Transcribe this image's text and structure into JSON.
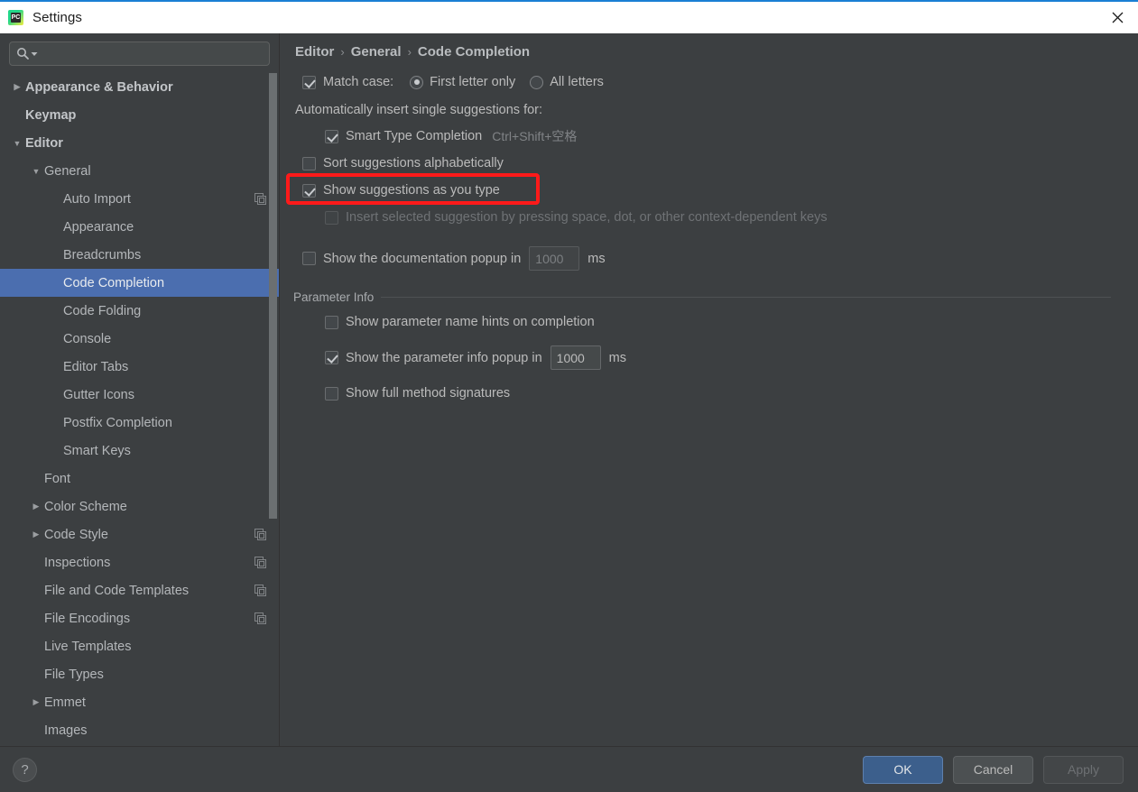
{
  "window": {
    "title": "Settings",
    "app_icon": "pycharm-icon",
    "icon_text": "PC",
    "close_icon": "close-icon",
    "accent_color": "#1a7fd4"
  },
  "sidebar": {
    "search": {
      "placeholder": "",
      "value": "",
      "icon": "search-icon",
      "dropdown_icon": "chevron-down-icon"
    },
    "items": [
      {
        "label": "Appearance & Behavior",
        "indent": 0,
        "arrow": "collapsed",
        "bold": true,
        "selected": false,
        "copy": false
      },
      {
        "label": "Keymap",
        "indent": 0,
        "arrow": "none",
        "bold": true,
        "selected": false,
        "copy": false
      },
      {
        "label": "Editor",
        "indent": 0,
        "arrow": "expanded",
        "bold": true,
        "selected": false,
        "copy": false
      },
      {
        "label": "General",
        "indent": 1,
        "arrow": "expanded",
        "bold": false,
        "selected": false,
        "copy": false
      },
      {
        "label": "Auto Import",
        "indent": 2,
        "arrow": "none",
        "bold": false,
        "selected": false,
        "copy": true
      },
      {
        "label": "Appearance",
        "indent": 2,
        "arrow": "none",
        "bold": false,
        "selected": false,
        "copy": false
      },
      {
        "label": "Breadcrumbs",
        "indent": 2,
        "arrow": "none",
        "bold": false,
        "selected": false,
        "copy": false
      },
      {
        "label": "Code Completion",
        "indent": 2,
        "arrow": "none",
        "bold": false,
        "selected": true,
        "copy": false
      },
      {
        "label": "Code Folding",
        "indent": 2,
        "arrow": "none",
        "bold": false,
        "selected": false,
        "copy": false
      },
      {
        "label": "Console",
        "indent": 2,
        "arrow": "none",
        "bold": false,
        "selected": false,
        "copy": false
      },
      {
        "label": "Editor Tabs",
        "indent": 2,
        "arrow": "none",
        "bold": false,
        "selected": false,
        "copy": false
      },
      {
        "label": "Gutter Icons",
        "indent": 2,
        "arrow": "none",
        "bold": false,
        "selected": false,
        "copy": false
      },
      {
        "label": "Postfix Completion",
        "indent": 2,
        "arrow": "none",
        "bold": false,
        "selected": false,
        "copy": false
      },
      {
        "label": "Smart Keys",
        "indent": 2,
        "arrow": "none",
        "bold": false,
        "selected": false,
        "copy": false
      },
      {
        "label": "Font",
        "indent": 1,
        "arrow": "none",
        "bold": false,
        "selected": false,
        "copy": false
      },
      {
        "label": "Color Scheme",
        "indent": 1,
        "arrow": "collapsed",
        "bold": false,
        "selected": false,
        "copy": false
      },
      {
        "label": "Code Style",
        "indent": 1,
        "arrow": "collapsed",
        "bold": false,
        "selected": false,
        "copy": true
      },
      {
        "label": "Inspections",
        "indent": 1,
        "arrow": "none",
        "bold": false,
        "selected": false,
        "copy": true
      },
      {
        "label": "File and Code Templates",
        "indent": 1,
        "arrow": "none",
        "bold": false,
        "selected": false,
        "copy": true
      },
      {
        "label": "File Encodings",
        "indent": 1,
        "arrow": "none",
        "bold": false,
        "selected": false,
        "copy": true
      },
      {
        "label": "Live Templates",
        "indent": 1,
        "arrow": "none",
        "bold": false,
        "selected": false,
        "copy": false
      },
      {
        "label": "File Types",
        "indent": 1,
        "arrow": "none",
        "bold": false,
        "selected": false,
        "copy": false
      },
      {
        "label": "Emmet",
        "indent": 1,
        "arrow": "collapsed",
        "bold": false,
        "selected": false,
        "copy": false
      },
      {
        "label": "Images",
        "indent": 1,
        "arrow": "none",
        "bold": false,
        "selected": false,
        "copy": false
      }
    ],
    "selection_color": "#4b6eaf"
  },
  "main": {
    "breadcrumb": [
      "Editor",
      "General",
      "Code Completion"
    ],
    "breadcrumb_separator": "›",
    "match_case": {
      "label": "Match case:",
      "checked": true,
      "options": [
        {
          "label": "First letter only",
          "selected": true
        },
        {
          "label": "All letters",
          "selected": false
        }
      ]
    },
    "auto_insert_header": "Automatically insert single suggestions for:",
    "smart_type": {
      "label": "Smart Type Completion",
      "checked": true,
      "shortcut": "Ctrl+Shift+空格"
    },
    "sort_alphabetically": {
      "label": "Sort suggestions alphabetically",
      "checked": false
    },
    "show_suggestions": {
      "label": "Show suggestions as you type",
      "checked": true,
      "highlighted": true
    },
    "insert_selected": {
      "label": "Insert selected suggestion by pressing space, dot, or other context-dependent keys",
      "checked": false,
      "disabled": true
    },
    "doc_popup": {
      "label": "Show the documentation popup in",
      "checked": false,
      "value": "1000",
      "unit": "ms",
      "disabled": true
    },
    "parameter_info": {
      "title": "Parameter Info",
      "name_hints": {
        "label": "Show parameter name hints on completion",
        "checked": false
      },
      "info_popup": {
        "label": "Show the parameter info popup in",
        "checked": true,
        "value": "1000",
        "unit": "ms"
      },
      "full_signatures": {
        "label": "Show full method signatures",
        "checked": false
      }
    },
    "annotation_color": "#ff1a1a"
  },
  "footer": {
    "help_label": "?",
    "buttons": [
      {
        "label": "OK",
        "style": "primary"
      },
      {
        "label": "Cancel",
        "style": "normal"
      },
      {
        "label": "Apply",
        "style": "disabled"
      }
    ]
  }
}
